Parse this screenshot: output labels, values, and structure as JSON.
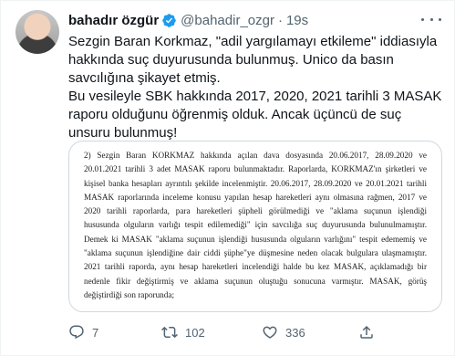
{
  "author": {
    "display_name": "bahadır özgür",
    "handle": "@bahadir_ozgr",
    "separator": "·",
    "time": "19s",
    "verified_icon": "verified-badge-icon",
    "verified_color": "#1d9bf0"
  },
  "tweet": {
    "paragraph1": "Sezgin Baran Korkmaz, \"adil yargılamayı etkileme\" iddiasıyla hakkında suç duyurusunda bulunmuş. Unico da basın savcılığına şikayet etmiş.",
    "paragraph2": "Bu vesileyle SBK hakkında 2017, 2020, 2021 tarihli 3 MASAK raporu olduğunu öğrenmiş olduk. Ancak üçüncü de suç unsuru bulunmuş!"
  },
  "document": {
    "lines": [
      "2) Sezgin Baran KORKMAZ hakkında açılan dava dosyasında 20.06.2017, 28.09.2020 ve",
      "20.01.2021 tarihli 3 adet MASAK raporu bulunmaktadır. Raporlarda, KORKMAZ'ın şirketleri ve",
      "kişisel banka hesapları ayrıntılı şekilde incelenmiştir. 20.06.2017, 28.09.2020 ve 20.01.2021 tarihli",
      "MASAK raporlarında inceleme konusu yapılan hesap hareketleri aynı olmasına rağmen, 2017 ve",
      "2020 tarihli raporlarda, para hareketleri şüpheli görülmediği ve \"aklama suçunun işlendiği",
      "hususunda olguların varlığı tespit edilemediği\" için savcılığa suç duyurusunda bulunulmamıştır.",
      "Demek ki MASAK \"aklama suçunun işlendiği hususunda olguların varlığını\" tespit edememiş ve",
      "\"aklama suçunun işlendiğine dair ciddi şüphe\"ye düşmesine neden olacak bulgulara ulaşmamıştır.",
      "2021 tarihli raporda, aynı hesap hareketleri incelendiği halde bu kez MASAK, açıklamadığı bir",
      "nedenle fikir değiştirmiş ve aklama suçunun oluştuğu sonucuna varmıştır. MASAK, görüş",
      "değiştirdiği son raporunda;"
    ]
  },
  "actions": {
    "reply_count": "7",
    "retweet_count": "102",
    "like_count": "336",
    "reply_icon": "reply-icon",
    "retweet_icon": "retweet-icon",
    "like_icon": "heart-icon",
    "share_icon": "share-icon"
  },
  "colors": {
    "text_primary": "#0f1419",
    "text_secondary": "#536471",
    "border": "#cfd9de",
    "verified": "#1d9bf0"
  }
}
